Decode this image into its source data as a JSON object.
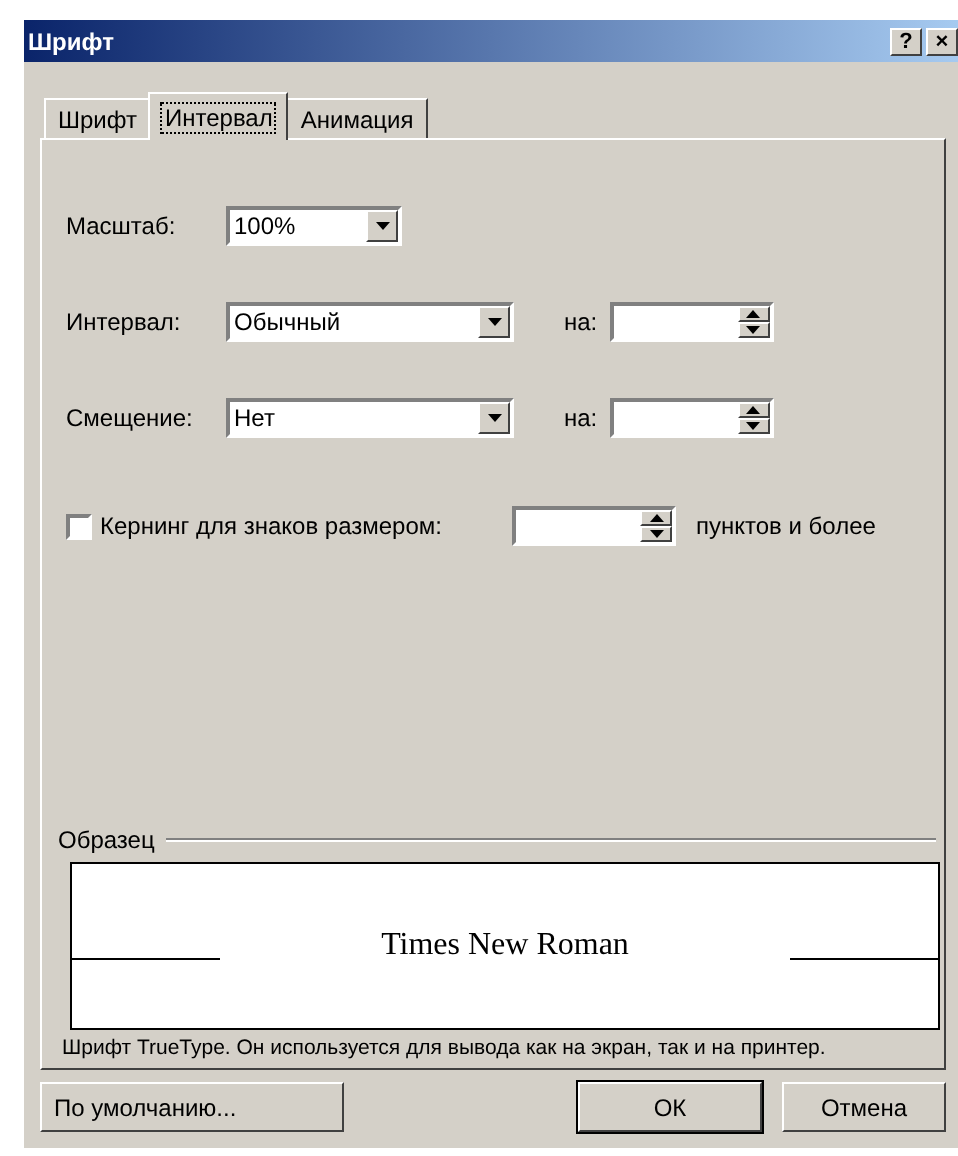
{
  "window": {
    "title": "Шрифт",
    "help_button": "?",
    "close_button": "×"
  },
  "tabs": [
    {
      "label": "Шрифт",
      "selected": false
    },
    {
      "label": "Интервал",
      "selected": true
    },
    {
      "label": "Анимация",
      "selected": false
    }
  ],
  "scale": {
    "label": "Масштаб:",
    "value": "100%"
  },
  "spacing": {
    "label": "Интервал:",
    "value": "Обычный",
    "by_label": "на:"
  },
  "position": {
    "label": "Смещение:",
    "value": "Нет",
    "by_label": "на:"
  },
  "kerning": {
    "label": "Кернинг для знаков размером:",
    "checked": false,
    "suffix": "пунктов и более"
  },
  "preview": {
    "title": "Образец",
    "sample": "Times New Roman",
    "description": "Шрифт TrueType. Он используется для вывода как на экран, так и на принтер."
  },
  "buttons": [
    {
      "label": "По умолчанию...",
      "kind": "default"
    },
    {
      "label": "ОК",
      "kind": "ok"
    },
    {
      "label": "Отмена",
      "kind": "cancel"
    }
  ]
}
